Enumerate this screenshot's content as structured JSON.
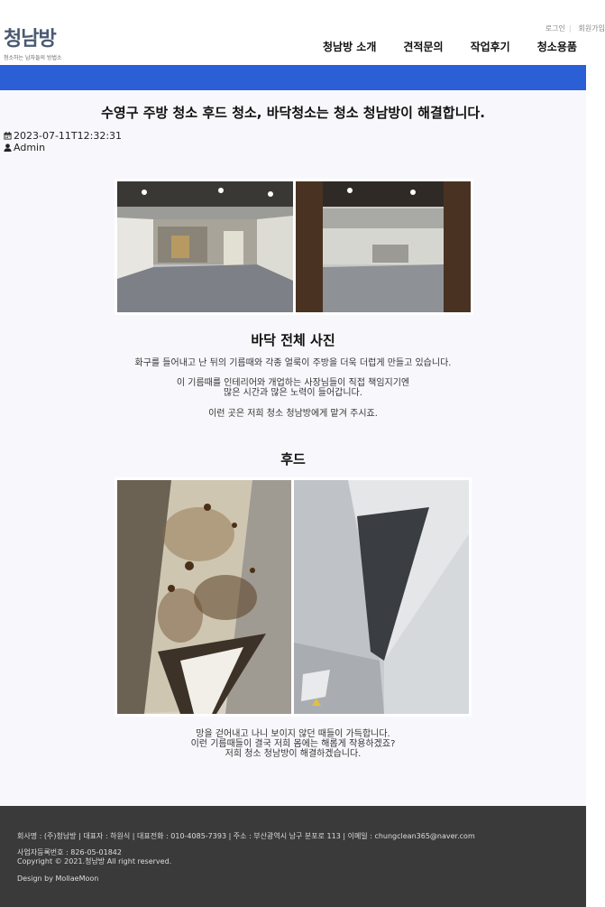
{
  "header": {
    "logo_text": "청남방",
    "logo_subtitle": "청소하는 남자들의 방법소",
    "login": "로그인",
    "signup": "회원가입",
    "nav": [
      "청남방 소개",
      "견적문의",
      "작업후기",
      "청소용품"
    ]
  },
  "post": {
    "title": "수영구 주방 청소 후드 청소, 바닥청소는 청소 청남방이 해결합니다.",
    "date": "2023-07-11T12:32:31",
    "author": "Admin"
  },
  "section1": {
    "heading": "바닥 전체 사진",
    "p1": "화구를 들어내고 난 뒤의 기름때와 각종 얼룩이 주방을 더욱 더럽게 만들고 있습니다.",
    "p2a": "이 기름때를 인테리어와 개업하는 사장님들이 직접 책임지기엔",
    "p2b": "많은 시간과 많은 노력이 들어갑니다.",
    "p3": "이런 곳은 저희 청소 청남방에게 맡겨 주시죠."
  },
  "section2": {
    "heading": "후드",
    "p1": "망을 걷어내고 나니 보이지 않던 때들이 가득합니다.",
    "p2": "이런 기름때들이 결국 저희 몸에는 해롭게 작용하겠죠?",
    "p3": "저희 청소 청남방이 해결하겠습니다."
  },
  "footer": {
    "info": "회사명 : (주)청남방  |  대표자 : 하원식  |  대표전화 : 010-4085-7393  |  주소 : 부산광역시 남구 분포로 113  |  이메일 : chungclean365@naver.com",
    "biz_no": "사업자등록번호 : 826-05-01842",
    "copyright": "Copyright © 2021.청남방 All right reserved.",
    "design": "Design by MollaeMoon"
  },
  "colors": {
    "accent_bar": "#2a5fd6",
    "footer_bg": "#3a3a3a",
    "logo": "#4a5a72"
  },
  "icons": [
    "calendar-icon",
    "user-icon"
  ]
}
